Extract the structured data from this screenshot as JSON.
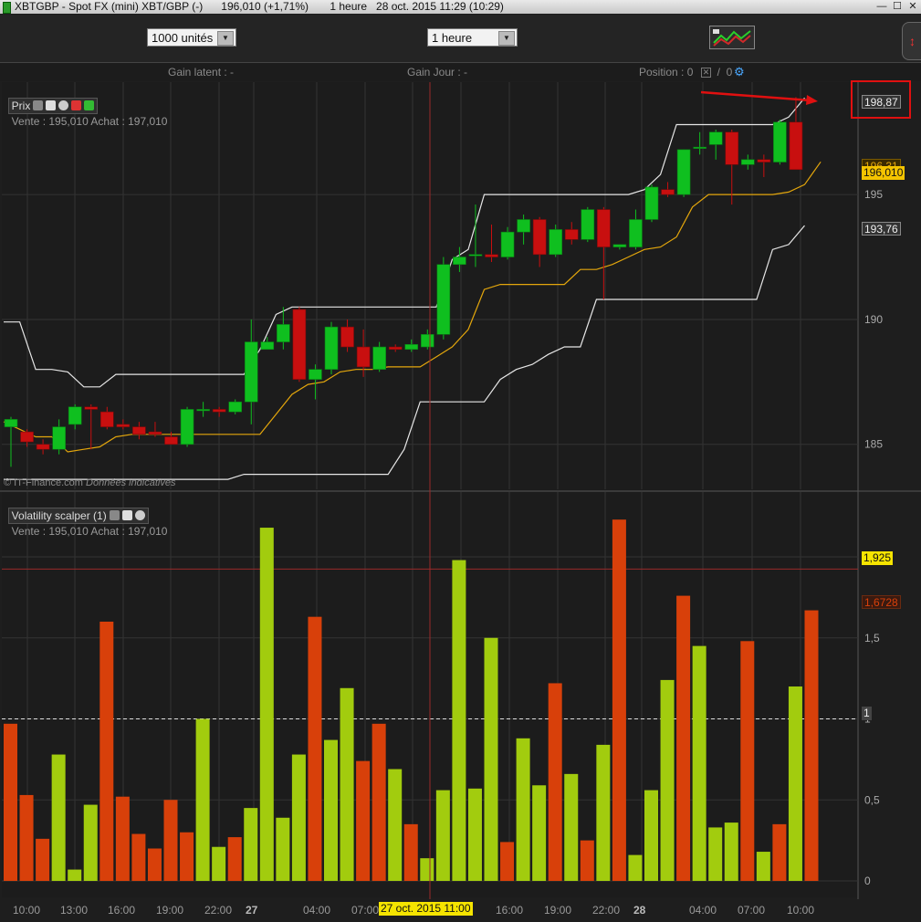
{
  "window": {
    "title": "XBTGBP - Spot FX (mini) XBT/GBP (-)      196,010 (+1,71%)       1 heure   28 oct. 2015 11:29 (10:29)",
    "min_label": "—",
    "max_label": "☐",
    "close_label": "✕"
  },
  "toolbar": {
    "units_value": "1000 unités",
    "period_value": "1 heure",
    "arrow_glyph": "▼",
    "right_icon_glyph": "↕"
  },
  "infobar": {
    "gain_latent": "Gain latent : -",
    "gain_jour": "Gain Jour : -",
    "position_label": "Position : 0",
    "position_sep": "  /  0"
  },
  "price_panel": {
    "tab_label": "Prix",
    "quote": "Vente : 195,010 Achat : 197,010",
    "watermark_a": "© IT-Finance.com",
    "watermark_b": "Données indicatives",
    "labels": {
      "upper": "198,87",
      "mid": "196,31",
      "current": "196,010",
      "lower": "193,76"
    }
  },
  "indicator_panel": {
    "tab_label": "Volatility scalper (1)",
    "quote": "Vente : 195,010 Achat : 197,010",
    "labels": {
      "level": "1,925",
      "last": "1,6728",
      "one": "1"
    }
  },
  "x_axis": {
    "labels": [
      "10:00",
      "13:00",
      "16:00",
      "19:00",
      "22:00",
      "27",
      "04:00",
      "07:00",
      "16:00",
      "19:00",
      "22:00",
      "28",
      "04:00",
      "07:00",
      "10:00"
    ],
    "bold": [
      "27",
      "28"
    ],
    "cursor_label": "27 oct. 2015 11:00"
  },
  "colors": {
    "bull": "#0fbf1f",
    "bear": "#c80f0f",
    "bar_up": "#a2cc0e",
    "bar_down": "#d8400a",
    "band": "#e6e6e6",
    "mid_band": "#e3a60c",
    "cursor": "#9a2a2a"
  },
  "chart_data": [
    {
      "type": "candlestick",
      "title": "Prix",
      "ylim": [
        183.2,
        199.5
      ],
      "y_ticks": [
        185,
        190,
        195
      ],
      "candles": [
        {
          "o": 185.7,
          "h": 186.1,
          "l": 184.1,
          "c": 186.0
        },
        {
          "o": 185.5,
          "h": 185.6,
          "l": 184.9,
          "c": 185.1
        },
        {
          "o": 185.0,
          "h": 185.2,
          "l": 184.6,
          "c": 184.8
        },
        {
          "o": 184.8,
          "h": 186.0,
          "l": 184.6,
          "c": 185.7
        },
        {
          "o": 185.8,
          "h": 186.6,
          "l": 185.6,
          "c": 186.5
        },
        {
          "o": 186.5,
          "h": 186.6,
          "l": 184.8,
          "c": 186.4
        },
        {
          "o": 186.3,
          "h": 186.5,
          "l": 185.6,
          "c": 185.7
        },
        {
          "o": 185.8,
          "h": 186.0,
          "l": 185.6,
          "c": 185.7
        },
        {
          "o": 185.7,
          "h": 185.9,
          "l": 185.2,
          "c": 185.4
        },
        {
          "o": 185.5,
          "h": 185.9,
          "l": 185.3,
          "c": 185.4
        },
        {
          "o": 185.3,
          "h": 185.5,
          "l": 185.0,
          "c": 185.0
        },
        {
          "o": 185.0,
          "h": 186.5,
          "l": 184.9,
          "c": 186.4
        },
        {
          "o": 186.4,
          "h": 186.7,
          "l": 186.1,
          "c": 186.4
        },
        {
          "o": 186.4,
          "h": 186.5,
          "l": 186.1,
          "c": 186.3
        },
        {
          "o": 186.3,
          "h": 186.8,
          "l": 186.2,
          "c": 186.7
        },
        {
          "o": 186.7,
          "h": 190.0,
          "l": 185.8,
          "c": 189.1
        },
        {
          "o": 188.8,
          "h": 189.3,
          "l": 188.8,
          "c": 189.1
        },
        {
          "o": 189.1,
          "h": 190.5,
          "l": 188.8,
          "c": 189.8
        },
        {
          "o": 190.4,
          "h": 190.5,
          "l": 187.5,
          "c": 187.6
        },
        {
          "o": 187.6,
          "h": 188.2,
          "l": 186.8,
          "c": 188.0
        },
        {
          "o": 188.0,
          "h": 189.9,
          "l": 187.8,
          "c": 189.7
        },
        {
          "o": 189.7,
          "h": 190.0,
          "l": 188.7,
          "c": 188.9
        },
        {
          "o": 188.9,
          "h": 189.6,
          "l": 187.7,
          "c": 188.1
        },
        {
          "o": 188.0,
          "h": 189.1,
          "l": 187.9,
          "c": 188.9
        },
        {
          "o": 188.9,
          "h": 189.0,
          "l": 188.7,
          "c": 188.8
        },
        {
          "o": 188.8,
          "h": 189.2,
          "l": 188.7,
          "c": 189.0
        },
        {
          "o": 188.9,
          "h": 189.6,
          "l": 188.8,
          "c": 189.4
        },
        {
          "o": 189.4,
          "h": 192.5,
          "l": 189.2,
          "c": 192.2
        },
        {
          "o": 192.2,
          "h": 192.9,
          "l": 191.9,
          "c": 192.5
        },
        {
          "o": 192.6,
          "h": 194.6,
          "l": 192.1,
          "c": 192.6
        },
        {
          "o": 192.6,
          "h": 193.8,
          "l": 192.3,
          "c": 192.5
        },
        {
          "o": 192.5,
          "h": 193.7,
          "l": 192.4,
          "c": 193.5
        },
        {
          "o": 193.5,
          "h": 194.2,
          "l": 193.0,
          "c": 194.0
        },
        {
          "o": 194.0,
          "h": 194.1,
          "l": 192.1,
          "c": 192.6
        },
        {
          "o": 192.6,
          "h": 193.8,
          "l": 192.5,
          "c": 193.6
        },
        {
          "o": 193.6,
          "h": 193.9,
          "l": 193.0,
          "c": 193.2
        },
        {
          "o": 193.2,
          "h": 194.5,
          "l": 193.1,
          "c": 194.4
        },
        {
          "o": 194.4,
          "h": 194.5,
          "l": 190.8,
          "c": 192.9
        },
        {
          "o": 192.9,
          "h": 193.0,
          "l": 192.8,
          "c": 193.0
        },
        {
          "o": 192.9,
          "h": 194.4,
          "l": 192.8,
          "c": 194.0
        },
        {
          "o": 194.0,
          "h": 195.4,
          "l": 193.9,
          "c": 195.3
        },
        {
          "o": 195.2,
          "h": 195.5,
          "l": 194.9,
          "c": 195.0
        },
        {
          "o": 195.0,
          "h": 196.8,
          "l": 194.9,
          "c": 196.8
        },
        {
          "o": 196.9,
          "h": 197.5,
          "l": 196.6,
          "c": 196.9
        },
        {
          "o": 197.0,
          "h": 197.6,
          "l": 196.4,
          "c": 197.5
        },
        {
          "o": 197.5,
          "h": 197.6,
          "l": 194.6,
          "c": 196.2
        },
        {
          "o": 196.2,
          "h": 196.6,
          "l": 196.0,
          "c": 196.4
        },
        {
          "o": 196.4,
          "h": 196.6,
          "l": 195.7,
          "c": 196.3
        },
        {
          "o": 196.3,
          "h": 198.0,
          "l": 196.2,
          "c": 197.9
        },
        {
          "o": 197.9,
          "h": 198.9,
          "l": 196.0,
          "c": 196.0
        }
      ],
      "upper_band": [
        189.9,
        189.9,
        188.0,
        188.0,
        187.9,
        187.3,
        187.3,
        187.8,
        187.8,
        187.8,
        187.8,
        187.8,
        187.8,
        187.8,
        187.8,
        187.8,
        188.8,
        190.2,
        190.5,
        190.5,
        190.5,
        190.5,
        190.5,
        190.5,
        190.5,
        190.5,
        190.5,
        190.5,
        192.4,
        192.8,
        195.0,
        195.0,
        195.0,
        195.0,
        195.0,
        195.0,
        195.0,
        195.0,
        195.0,
        195.0,
        195.2,
        195.8,
        197.8,
        197.8,
        197.8,
        197.8,
        197.8,
        197.8,
        197.8,
        198.1,
        198.87
      ],
      "mid_band": [
        185.9,
        185.6,
        185.3,
        185.3,
        184.7,
        184.8,
        184.9,
        185.3,
        185.4,
        185.4,
        185.4,
        185.4,
        185.4,
        185.4,
        185.4,
        185.4,
        185.4,
        186.2,
        187.0,
        187.4,
        187.5,
        187.9,
        188.0,
        188.0,
        188.1,
        188.1,
        188.1,
        188.5,
        188.9,
        189.6,
        191.2,
        191.4,
        191.4,
        191.4,
        191.4,
        191.4,
        192.0,
        192.0,
        192.2,
        192.5,
        192.8,
        192.9,
        193.3,
        194.5,
        195.0,
        195.0,
        195.0,
        195.0,
        195.0,
        195.1,
        195.4,
        196.31
      ],
      "lower_band": [
        183.6,
        183.6,
        183.6,
        183.6,
        183.6,
        183.6,
        183.6,
        183.6,
        183.6,
        183.6,
        183.6,
        183.6,
        183.6,
        183.6,
        183.6,
        183.8,
        183.8,
        183.8,
        183.8,
        183.8,
        183.8,
        183.8,
        183.8,
        183.8,
        183.8,
        184.8,
        186.7,
        186.7,
        186.7,
        186.7,
        186.7,
        187.6,
        188.0,
        188.2,
        188.6,
        188.9,
        188.9,
        190.8,
        190.8,
        190.8,
        190.8,
        190.8,
        190.8,
        190.8,
        190.8,
        190.8,
        190.8,
        190.8,
        192.8,
        193.0,
        193.76
      ]
    },
    {
      "type": "bar",
      "title": "Volatility scalper (1)",
      "ylim": [
        0,
        2.4
      ],
      "y_ticks": [
        0,
        0.5,
        1,
        1.5,
        2
      ],
      "reference_level": 1.925,
      "dashed_level": 1,
      "series": [
        {
          "values": [
            0.97,
            0.53,
            0.26,
            0.78,
            0.07,
            0.47,
            1.6,
            0.52,
            0.29,
            0.2,
            0.5,
            0.3,
            1.0,
            0.21,
            0.27,
            0.45,
            2.18,
            0.39,
            0.78,
            1.63,
            0.87,
            1.19,
            0.74,
            0.97,
            0.69,
            0.35,
            0.14,
            0.56,
            1.98,
            0.57,
            1.5,
            0.24,
            0.88,
            0.59,
            1.22,
            0.66,
            0.25,
            0.84,
            2.23,
            0.16,
            0.56,
            1.24,
            1.76,
            1.45,
            0.33,
            0.36,
            1.48,
            0.18,
            0.35,
            1.2,
            1.67
          ],
          "direction": [
            "down",
            "down",
            "down",
            "up",
            "up",
            "up",
            "down",
            "down",
            "down",
            "down",
            "down",
            "down",
            "up",
            "up",
            "down",
            "up",
            "up",
            "up",
            "up",
            "down",
            "up",
            "up",
            "down",
            "down",
            "up",
            "down",
            "up",
            "up",
            "up",
            "up",
            "up",
            "down",
            "up",
            "up",
            "down",
            "up",
            "down",
            "up",
            "down",
            "up",
            "up",
            "up",
            "down",
            "up",
            "up",
            "up",
            "down",
            "up",
            "down",
            "up",
            "down"
          ]
        }
      ]
    }
  ]
}
